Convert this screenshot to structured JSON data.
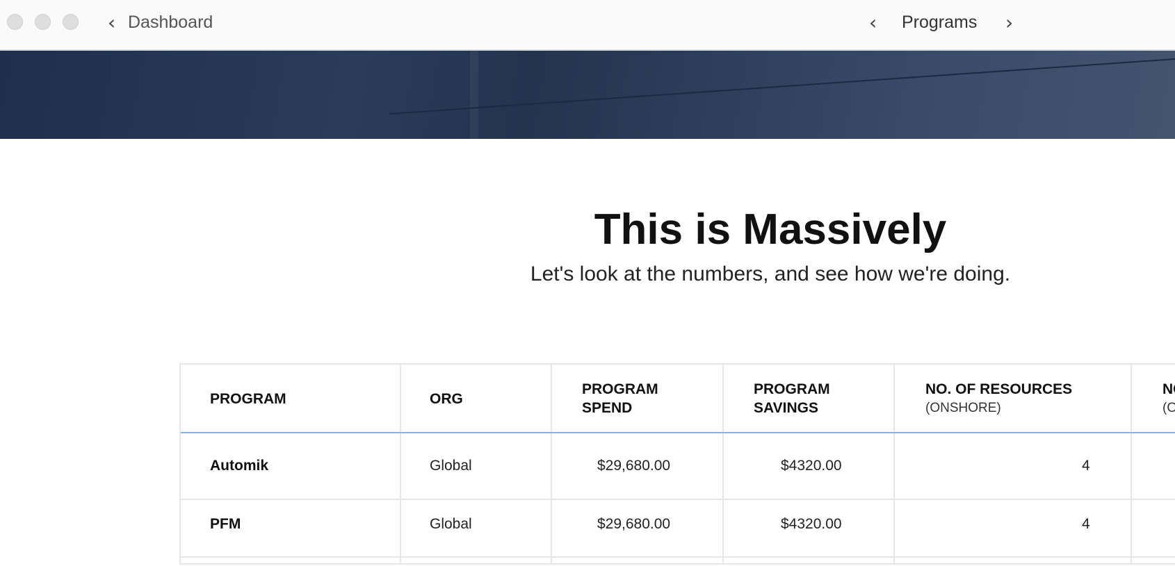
{
  "titlebar": {
    "back_label": "Dashboard",
    "section_title": "Programs"
  },
  "hero": {
    "title": "This is Massively",
    "subtitle": "Let's look at the numbers, and see how we're doing."
  },
  "table": {
    "headers": [
      {
        "label": "PROGRAM"
      },
      {
        "label": "ORG"
      },
      {
        "label": "PROGRAM",
        "label2": "SPEND"
      },
      {
        "label": "PROGRAM",
        "label2": "SAVINGS"
      },
      {
        "label": "NO. OF RESOURCES",
        "sub": "(ONSHORE)"
      },
      {
        "label": "NO",
        "sub": "(O"
      }
    ],
    "rows": [
      {
        "program": "Automik",
        "org": "Global",
        "spend": "$29,680.00",
        "savings": "$4320.00",
        "onshore": "4"
      },
      {
        "program": "PFM",
        "org": "Global",
        "spend": "$29,680.00",
        "savings": "$4320.00",
        "onshore": "4"
      }
    ]
  }
}
